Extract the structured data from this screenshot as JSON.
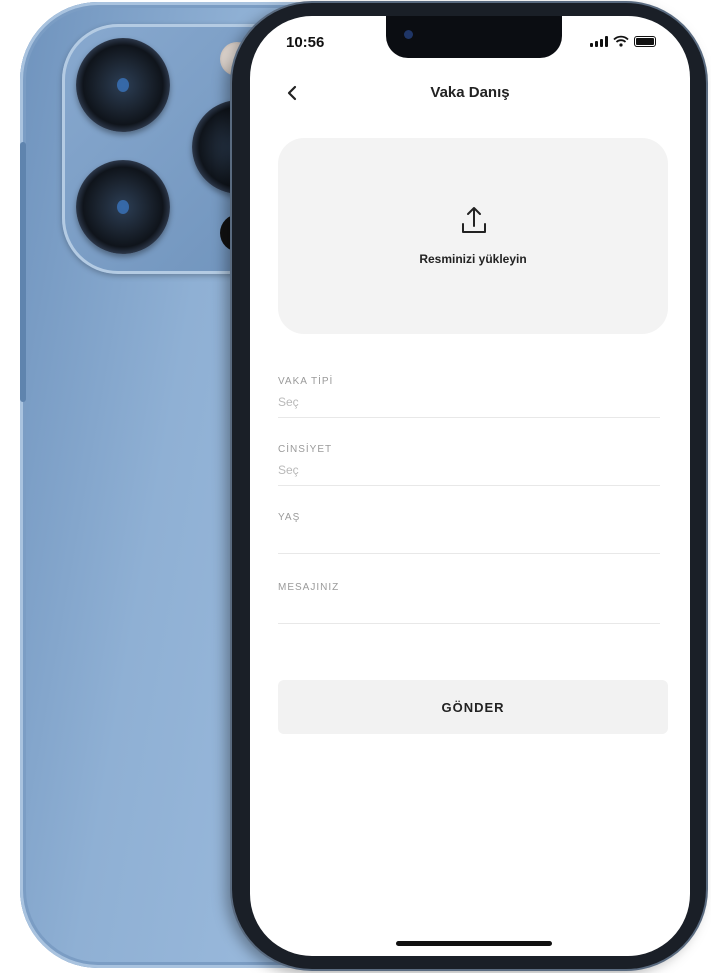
{
  "status_bar": {
    "time": "10:56",
    "icons": [
      "signal-icon",
      "wifi-icon",
      "battery-icon"
    ]
  },
  "header": {
    "back_icon": "chevron-left-icon",
    "title": "Vaka Danış"
  },
  "upload": {
    "icon": "upload-icon",
    "label": "Resminizi yükleyin"
  },
  "form": {
    "fields": [
      {
        "label": "VAKA TİPİ",
        "value": "Seç"
      },
      {
        "label": "CİNSİYET",
        "value": "Seç"
      },
      {
        "label": "YAŞ",
        "value": ""
      },
      {
        "label": "MESAJINIZ",
        "value": ""
      }
    ],
    "submit_label": "GÖNDER"
  },
  "colors": {
    "phone_body": "#8fb0d4",
    "upload_bg": "#f3f3f3",
    "button_bg": "#f2f2f2",
    "label_gray": "#9a9a9a"
  }
}
